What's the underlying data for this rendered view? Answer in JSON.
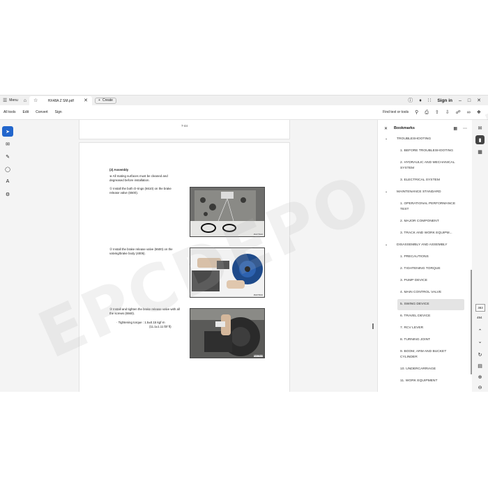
{
  "titlebar": {
    "menu_label": "Menu",
    "tab_title": "HX48A Z SM.pdf",
    "create_label": "Create",
    "sign_in_label": "Sign in"
  },
  "menubar": {
    "items": [
      "All tools",
      "Edit",
      "Convert",
      "Sign"
    ],
    "find_label": "Find text or tools"
  },
  "document": {
    "page_number_top": "7-44",
    "section_title": "(2) Assembly",
    "note": "※ All mating surfaces must be cleaned and degreased before installation.",
    "step1": "① Install the both O-rings (6610) on the brake release valve (6500).",
    "step2": "② Install the brake release valve (6500) on the valving/brake body (4005).",
    "step3": "③ Install and tighten the brake release valve with all the screws (6560).",
    "torque_line1": "· Tightening torque : 1.5±0.15 kgf·m",
    "torque_line2": "(11.1±1.11 lbf·ft)",
    "photo1_caption": "48AZ7SM24",
    "photo2_caption": "48AZ7SM12",
    "photo3_caption": "48AZ7SM13"
  },
  "watermark": "EPCDEPO.COM",
  "bookmarks": {
    "title": "Bookmarks",
    "items": [
      {
        "label": "TROUBLESHOOTING",
        "type": "section"
      },
      {
        "label": "1. BEFORE TROUBLESHOOTING",
        "type": "child"
      },
      {
        "label": "2. HYDRAULIC AND MECHANICAL SYSTEM",
        "type": "child"
      },
      {
        "label": "3. ELECTRICAL SYSTEM",
        "type": "child"
      },
      {
        "label": "MAINTENANCE STANDARD",
        "type": "section"
      },
      {
        "label": "1. OPERATIONAL PERFORMANCE TEST",
        "type": "child"
      },
      {
        "label": "2. MAJOR COMPONENT",
        "type": "child"
      },
      {
        "label": "3. TRACK AND WORK EQUIPM...",
        "type": "child"
      },
      {
        "label": "DISASSEMBLY AND ASSEMBLY",
        "type": "section"
      },
      {
        "label": "1. PRECAUTIONS",
        "type": "child"
      },
      {
        "label": "2. TIGHTENING TORQUE",
        "type": "child"
      },
      {
        "label": "3. PUMP DEVICE",
        "type": "child"
      },
      {
        "label": "4. MAIN CONTROL VALVE",
        "type": "child"
      },
      {
        "label": "5. SWING DEVICE",
        "type": "child",
        "selected": true
      },
      {
        "label": "6. TRAVEL DEVICE",
        "type": "child"
      },
      {
        "label": "7. RCV LEVER",
        "type": "child"
      },
      {
        "label": "8. TURNING JOINT",
        "type": "child"
      },
      {
        "label": "9. BOOM, ARM AND BUCKET CYLINDER",
        "type": "child"
      },
      {
        "label": "10. UNDERCARRIAGE",
        "type": "child"
      },
      {
        "label": "11. WORK EQUIPMENT",
        "type": "child"
      }
    ]
  },
  "pager": {
    "current_page": "383",
    "total_pages": "494"
  },
  "colors": {
    "accent": "#2266cc",
    "selected_bookmark": "#e4e4e4"
  }
}
